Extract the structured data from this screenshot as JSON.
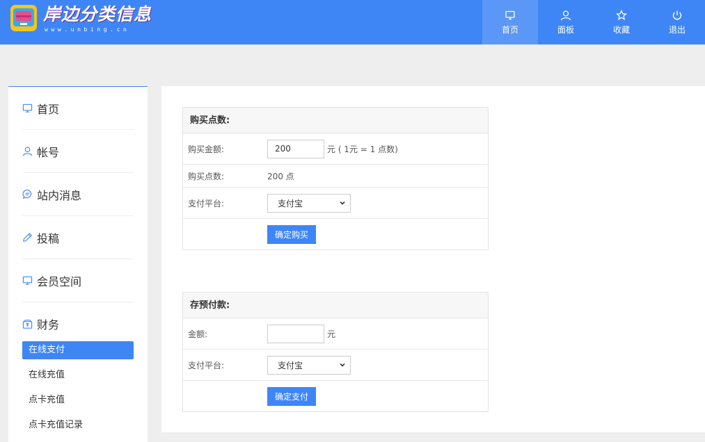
{
  "brand": {
    "name": "岸边分类信息",
    "sub": "www.unbing.cn"
  },
  "nav": [
    {
      "label": "首页",
      "icon": "monitor-icon",
      "active": true
    },
    {
      "label": "面板",
      "icon": "user-icon"
    },
    {
      "label": "收藏",
      "icon": "star-icon"
    },
    {
      "label": "退出",
      "icon": "power-icon"
    }
  ],
  "sidebar": {
    "items": [
      {
        "label": "首页",
        "icon": "monitor-icon"
      },
      {
        "label": "帐号",
        "icon": "user-icon"
      },
      {
        "label": "站内消息",
        "icon": "message-icon"
      },
      {
        "label": "投稿",
        "icon": "pen-icon"
      },
      {
        "label": "会员空间",
        "icon": "monitor-icon"
      },
      {
        "label": "财务",
        "icon": "wallet-icon"
      }
    ],
    "subitems": [
      {
        "label": "在线支付",
        "active": true
      },
      {
        "label": "在线充值"
      },
      {
        "label": "点卡充值"
      },
      {
        "label": "点卡充值记录"
      }
    ]
  },
  "buy_points": {
    "title": "购买点数:",
    "amount_label": "购买金额:",
    "amount_value": "200",
    "amount_unit": "元 ( 1元 = 1 点数)",
    "points_label": "购买点数:",
    "points_value": "200 点",
    "platform_label": "支付平台:",
    "platform_value": "支付宝",
    "submit_label": "确定购买"
  },
  "prepay": {
    "title": "存预付款:",
    "amount_label": "金额:",
    "amount_value": "",
    "amount_unit": "元",
    "platform_label": "支付平台:",
    "platform_value": "支付宝",
    "submit_label": "确定支付"
  },
  "colors": {
    "primary": "#3e86f5",
    "nav_active": "#5a97f6",
    "background": "#eeeeee"
  }
}
